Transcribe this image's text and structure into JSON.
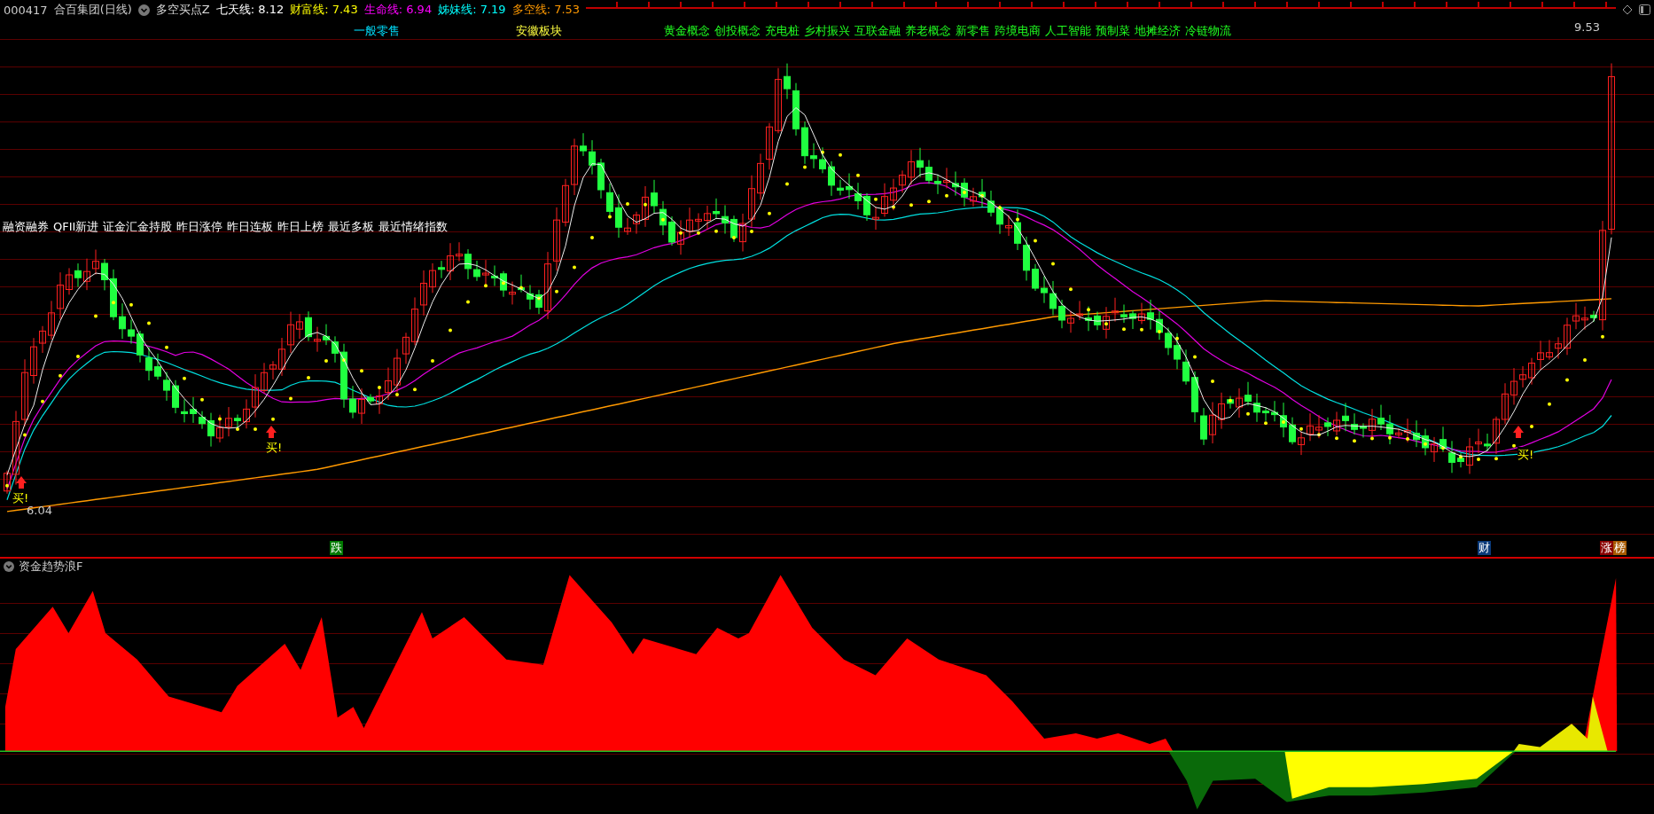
{
  "header": {
    "code": "000417",
    "name": "合百集团(日线)",
    "indicator": "多空买点Z",
    "lines": [
      {
        "label": "七天线:",
        "value": "8.12",
        "color": "#ffffff"
      },
      {
        "label": "财富线:",
        "value": "7.43",
        "color": "#ffff00"
      },
      {
        "label": "生命线:",
        "value": "6.94",
        "color": "#ff00ff"
      },
      {
        "label": "姊妹线:",
        "value": "7.19",
        "color": "#00ffff"
      },
      {
        "label": "多空线:",
        "value": "7.53",
        "color": "#ff9900"
      }
    ]
  },
  "main_chart": {
    "industry_tag": "一般零售",
    "region_tag": "安徽板块",
    "concept_tags": [
      "黄金概念",
      "创投概念",
      "充电桩",
      "乡村振兴",
      "互联金融",
      "养老概念",
      "新零售",
      "跨境电商",
      "人工智能",
      "预制菜",
      "地摊经济",
      "冷链物流"
    ],
    "feature_tags": [
      "融资融券",
      "QFII新进",
      "证金汇金持股",
      "昨日涨停",
      "昨日连板",
      "昨日上榜",
      "最近多板",
      "最近情绪指数"
    ],
    "buy_signals": [
      "买!",
      "买!",
      "买!"
    ],
    "low_label": "6.04",
    "high_label": "9.53",
    "markers": [
      {
        "text": "跌",
        "color": "#007a00"
      },
      {
        "text": "财",
        "color": "#0a3a7a"
      },
      {
        "text": "涨",
        "color": "#8a0000"
      },
      {
        "text": "榜",
        "color": "#a85a00"
      }
    ]
  },
  "sub_chart": {
    "title": "资金趋势浪F"
  }
}
